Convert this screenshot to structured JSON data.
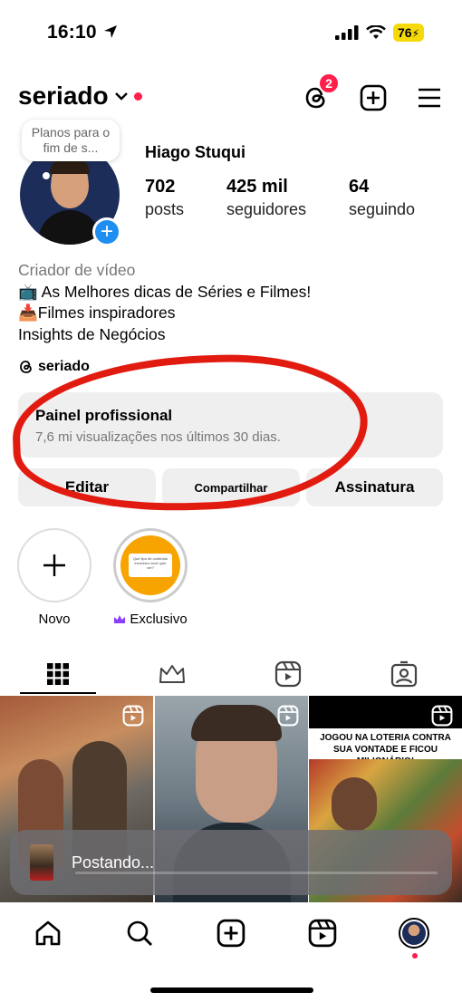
{
  "status_bar": {
    "time": "16:10",
    "battery": "76"
  },
  "header": {
    "username": "seriado",
    "threads_badge": "2"
  },
  "profile": {
    "note": "Planos para o fim de s...",
    "name": "Hiago Stuqui",
    "stats": [
      {
        "value": "702",
        "label": "posts"
      },
      {
        "value": "425 mil",
        "label": "seguidores"
      },
      {
        "value": "64",
        "label": "seguindo"
      }
    ],
    "category": "Criador de vídeo",
    "bio_lines": [
      "📺 As Melhores dicas de Séries e Filmes!",
      "📥Filmes inspiradores",
      "Insights de Negócios"
    ],
    "threads_handle": "seriado"
  },
  "pro_panel": {
    "title": "Painel profissional",
    "subtitle": "7,6 mi visualizações nos últimos 30 dias."
  },
  "buttons": {
    "edit": "Editar",
    "share": "Compartilhar",
    "subscription": "Assinatura"
  },
  "highlights": [
    {
      "label": "Novo"
    },
    {
      "label": "Exclusivo",
      "card_text": "Que tipo de conteúdo exclusivo você quer ver?"
    }
  ],
  "grid": {
    "post3_caption": "JOGOU NA LOTERIA CONTRA SUA VONTADE E FICOU MILIONÁRIO!"
  },
  "toast": {
    "text": "Postando..."
  },
  "colors": {
    "accent_red": "#ff1f4b",
    "annotation_red": "#e21b10",
    "blue": "#1f8ef1",
    "highlight_orange": "#f7a400"
  }
}
